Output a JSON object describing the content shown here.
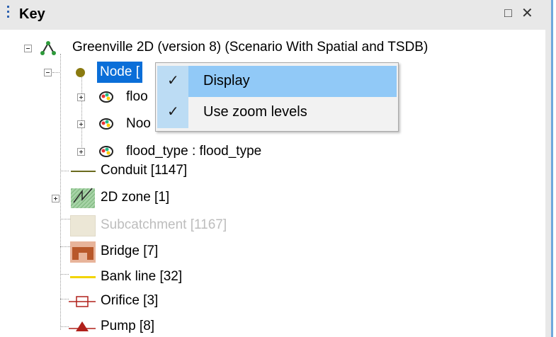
{
  "panel": {
    "title": "Key",
    "restore_icon": "□",
    "close_icon": "✕"
  },
  "tree": {
    "root": "Greenville 2D (version 8) (Scenario With Spatial and TSDB)",
    "node": "Node [",
    "node_children": [
      "floo",
      "Noo",
      "flood_type : flood_type"
    ],
    "items": [
      "Conduit [1147]",
      "2D zone [1]",
      "Subcatchment [1167]",
      "Bridge [7]",
      "Bank line [32]",
      "Orifice [3]",
      "Pump [8]"
    ]
  },
  "context_menu": {
    "items": [
      {
        "label": "Display",
        "checked": true,
        "highlighted": true
      },
      {
        "label": "Use zoom levels",
        "checked": true,
        "highlighted": false
      }
    ],
    "check_glyph": "✓"
  },
  "colors": {
    "selection": "#0a6ed8",
    "menu_highlight": "#91c9f7",
    "node_dot": "#8a7a10",
    "conduit_line": "#6b6b1e",
    "bank_line": "#f2d400",
    "orifice": "#b0201a",
    "pump": "#b0201a",
    "bridge": "#b8582a"
  }
}
